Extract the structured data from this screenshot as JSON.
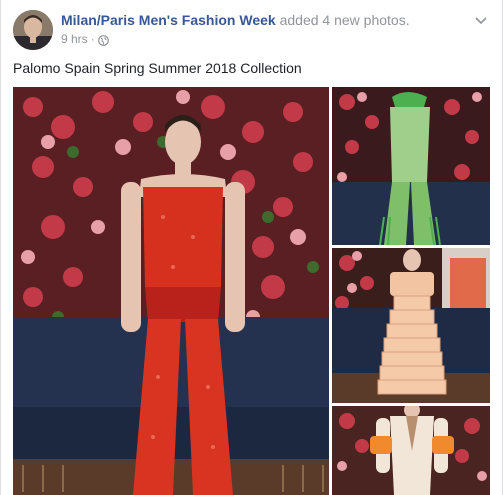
{
  "post": {
    "page_name": "Milan/Paris Men's Fashion Week",
    "action_text": "added 4 new photos.",
    "timestamp": "9 hrs",
    "separator": "·",
    "privacy_icon": "globe-icon",
    "menu_icon": "chevron-down-icon",
    "caption": "Palomo Spain Spring Summer 2018 Collection"
  },
  "photos": [
    {
      "name": "photo-main",
      "subject": "red sequin outfit"
    },
    {
      "name": "photo-2",
      "subject": "green fringed outfit"
    },
    {
      "name": "photo-3",
      "subject": "peach ruffled outfit"
    },
    {
      "name": "photo-4",
      "subject": "cream outfit with orange cuffs"
    }
  ],
  "colors": {
    "link": "#365899",
    "meta": "#90949c",
    "text": "#1d2129"
  }
}
